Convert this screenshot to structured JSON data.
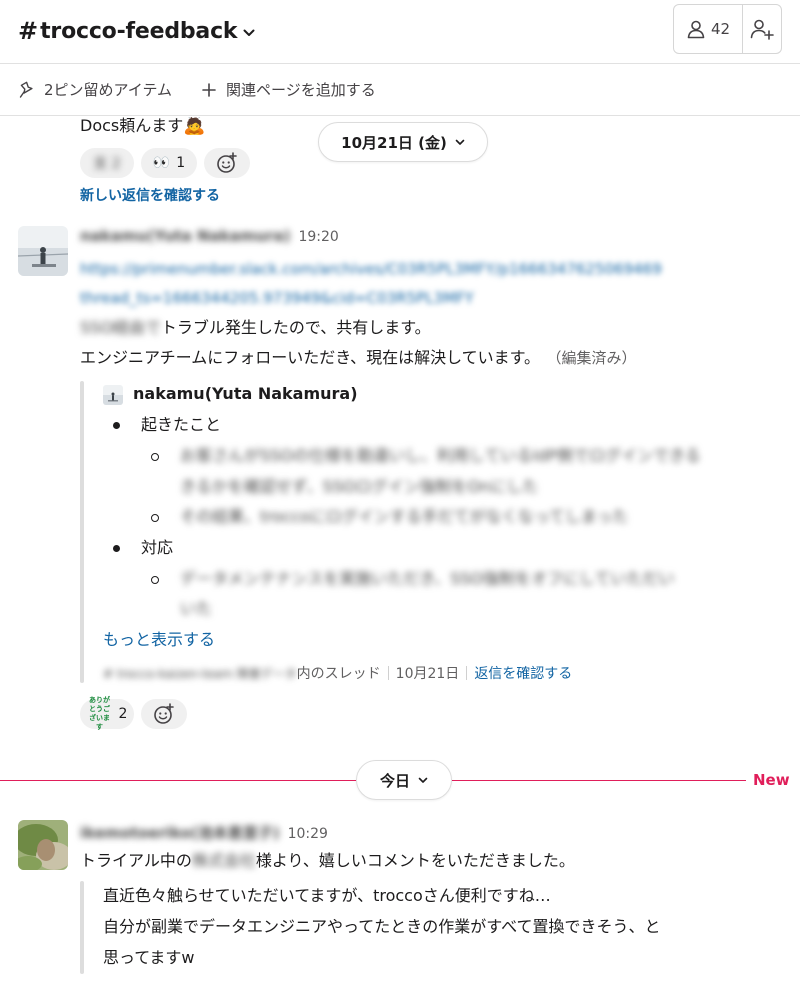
{
  "header": {
    "hash": "#",
    "channel_name": "trocco-feedback",
    "member_count": "42"
  },
  "bookmarks": {
    "pinned": "2ピン留めアイテム",
    "add_page": "関連ページを追加する"
  },
  "thread_prev": {
    "text_tail": "Docs頼んます",
    "emoji": "🙇",
    "reaction_blurred": "支 2",
    "reaction_eyes_emoji": "👀",
    "reaction_eyes_count": "1",
    "view_replies": "新しい返信を確認する"
  },
  "date_divider_1": {
    "label": "10月21日 (金)"
  },
  "message_1": {
    "user": "nakamu(Yuta Nakamura)",
    "time": "19:20",
    "link_line1": "https://primenumber.slack.com/archives/C03R5PL3MFY/p1666347625069469",
    "link_line2": "thread_ts=1666344205.973949&cid=C03R5PL3MFY",
    "text1_blur": "SSO経由で",
    "text1": "トラブル発生したので、共有します。",
    "text2": "エンジニアチームにフォローいただき、現在は解決しています。",
    "edited": "（編集済み）",
    "reaction_thanks_label": "ありがとうございます",
    "reaction_thanks_count": "2"
  },
  "shared": {
    "user": "nakamu(Yuta Nakamura)",
    "bullet1": "起きたこと",
    "sub1_line1": "お客さんがSSOの仕様を勘違いし、利用しているIdP側でログインできる",
    "sub1_line2": "きるかを確認せず、SSOログイン強制をOnにした",
    "sub2": "その結果、troccoにログインする手だてがなくなってしまった",
    "bullet2": "対応",
    "sub3_line1": "データメンテナンスを実施いただき、SSO強制をオフにしていただい",
    "sub3_line2": "いた",
    "show_more": "もっと表示する",
    "footer_blur": "# trocco-kaizen-team 障害データ",
    "footer_thread": "内のスレッド",
    "footer_date": "10月21日",
    "footer_view": "返信を確認する"
  },
  "divider_today": {
    "label": "今日",
    "new": "New"
  },
  "message_2": {
    "user": "ikemotoeriko(池本恵里子)",
    "time": "10:29",
    "text_pre": "トライアル中の",
    "text_blur": "株式会社",
    "text_post": "様より、嬉しいコメントをいただきました。",
    "quote1": "直近色々触らせていただいてますが、troccoさん便利ですね…",
    "quote2": "自分が副業でデータエンジニアやってたときの作業がすべて置換できそう、と",
    "quote3": "思ってますw"
  }
}
